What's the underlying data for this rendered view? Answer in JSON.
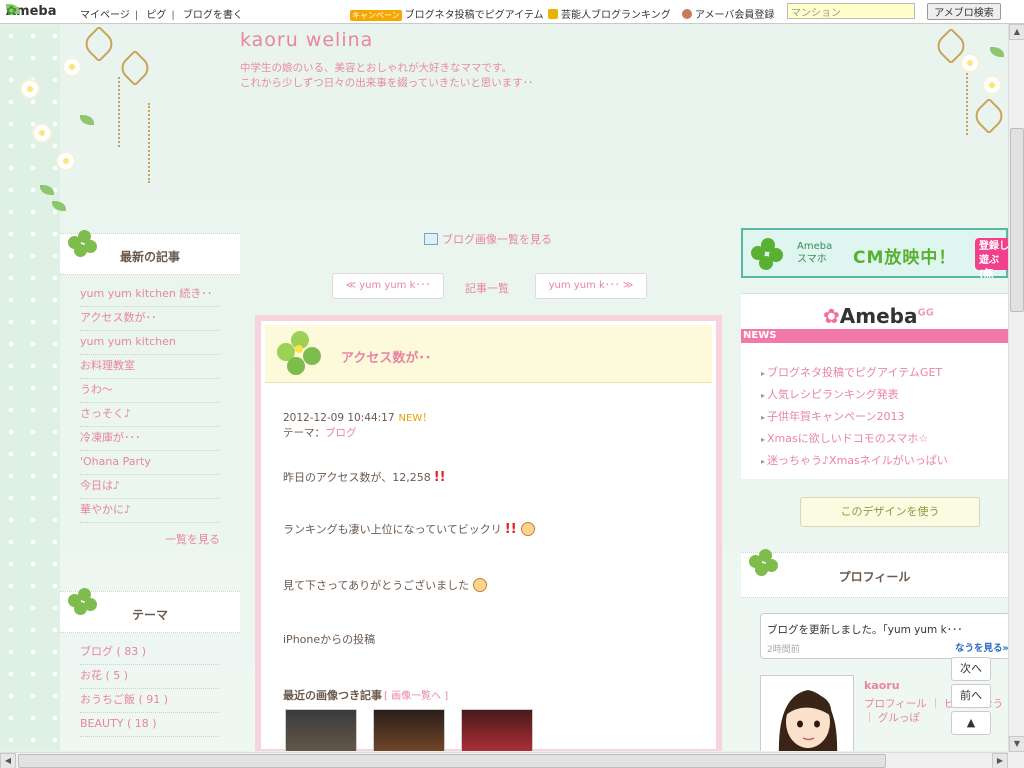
{
  "topbar": {
    "logo": "Ameba",
    "nav": [
      "マイページ",
      "ピグ",
      "ブログを書く"
    ],
    "promo_badge": "キャンペーン",
    "promo": "ブログネタ投稿でピグアイテム",
    "ranking": "芸能人ブログランキング",
    "member": "アメーバ会員登録",
    "search_value": "マンション",
    "search_button": "アメブロ検索"
  },
  "header": {
    "title": "kaoru welina",
    "desc_line1": "中学生の娘のいる、美容とおしゃれが大好きなママです。",
    "desc_line2": "これから少しずつ日々の出来事を綴っていきたいと思います･･"
  },
  "sidebar": {
    "latest": {
      "title": "最新の記事",
      "items": [
        "yum yum kitchen 続き･･",
        "アクセス数が･･",
        "yum yum kitchen",
        "お料理教室",
        "うわ～",
        "さっそく♪",
        "冷凍庫が･･･",
        "'Ohana Party",
        "今日は♪",
        "華やかに♪"
      ],
      "more": "一覧を見る"
    },
    "theme": {
      "title": "テーマ",
      "items": [
        "ブログ ( 83 )",
        "お花 ( 5 )",
        "おうちご飯 ( 91 )",
        "BEAUTY ( 18 )"
      ]
    }
  },
  "main": {
    "image_list_link": "ブログ画像一覧を見る",
    "prev_post": "≪ yum yum k･･･",
    "index": "記事一覧",
    "next_post": "yum yum k･･･ ≫",
    "article": {
      "title": "アクセス数が･･",
      "date": "2012-12-09 10:44:17",
      "new_badge": "NEW！",
      "theme_label": "テーマ：",
      "theme_value": "ブログ",
      "p1": "昨日のアクセス数が、12,258",
      "p2": "ランキングも凄い上位になっていてビックリ",
      "p3": "見て下さってありがとうございました",
      "p4": "iPhoneからの投稿",
      "recent_title": "最近の画像つき記事",
      "recent_link": "[ 画像一覧へ ]"
    }
  },
  "right": {
    "cm": {
      "brand_line1": "Ameba",
      "brand_line2": "スマホ",
      "headline": "CM放映中！",
      "cta_line1": "登録し",
      "cta_line2": "遊ぶ(無"
    },
    "gg": {
      "logo": "Ameba",
      "logo_sup": "GG",
      "news": "NEWS",
      "items": [
        "ブログネタ投稿でピグアイテムGET",
        "人気レシピランキング発表",
        "子供年賀キャンペーン2013",
        "Xmasに欲しいドコモのスマホ☆",
        "迷っちゃう♪Xmasネイルがいっぱい"
      ]
    },
    "use_design": "このデザインを使う",
    "profile": {
      "title": "プロフィール",
      "bubble_msg": "ブログを更新しました。「yum yum k･･･",
      "bubble_time": "2時間前",
      "bubble_more": "なうを見る»",
      "name": "kaoru",
      "links": "プロフィール ｜ ピグ ｜ なう ｜ グルっぽ"
    },
    "nav_next": "次へ",
    "nav_prev": "前へ",
    "nav_top": "▲"
  },
  "colors": {
    "accent_pink": "#e984a3",
    "bg_mint": "#e7f3ea",
    "article_border": "#f7d4dd",
    "news_pink": "#f179a7"
  }
}
